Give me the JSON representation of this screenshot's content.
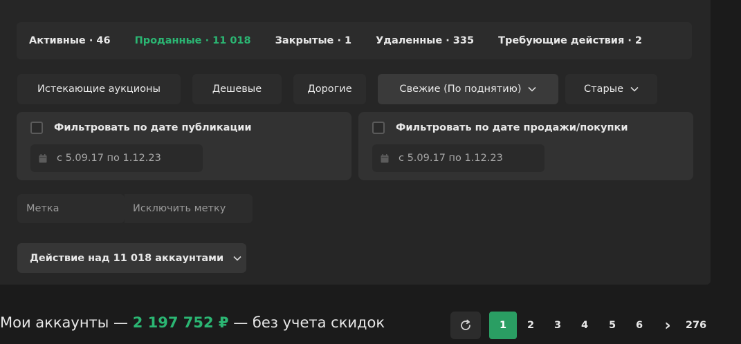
{
  "tabs": [
    {
      "label": "Активные · 46"
    },
    {
      "label": "Проданные · 11 018",
      "active": true
    },
    {
      "label": "Закрытые · 1"
    },
    {
      "label": "Удаленные · 335"
    },
    {
      "label": "Требующие действия · 2"
    }
  ],
  "sort": {
    "expiring": "Истекающие аукционы",
    "cheap": "Дешевые",
    "expensive": "Дорогие",
    "fresh": "Свежие (По поднятию)",
    "old": "Старые"
  },
  "filters": {
    "publication": {
      "label": "Фильтровать по дате публикации",
      "range": "с 5.09.17 по 1.12.23",
      "checked": false
    },
    "sale": {
      "label": "Фильтровать по дате продажи/покупки",
      "range": "с 5.09.17 по 1.12.23",
      "checked": false
    }
  },
  "tags": {
    "include_placeholder": "Метка",
    "exclude_placeholder": "Исключить метку"
  },
  "action": {
    "label": "Действие над 11 018 аккаунтами"
  },
  "summary": {
    "prefix": "Мои аккаунты — ",
    "amount": "2 197 752 ₽",
    "suffix": " — без учета скидок"
  },
  "pagination": {
    "pages": [
      "1",
      "2",
      "3",
      "4",
      "5",
      "6"
    ],
    "current": "1",
    "next": "›",
    "last": "276"
  },
  "colors": {
    "accent": "#2bb673",
    "panel": "#262626",
    "background": "#1b1b1b"
  },
  "icons": {
    "chevron": "chevron-down-icon",
    "calendar": "calendar-icon",
    "refresh": "refresh-icon",
    "next": "chevron-right-icon"
  }
}
